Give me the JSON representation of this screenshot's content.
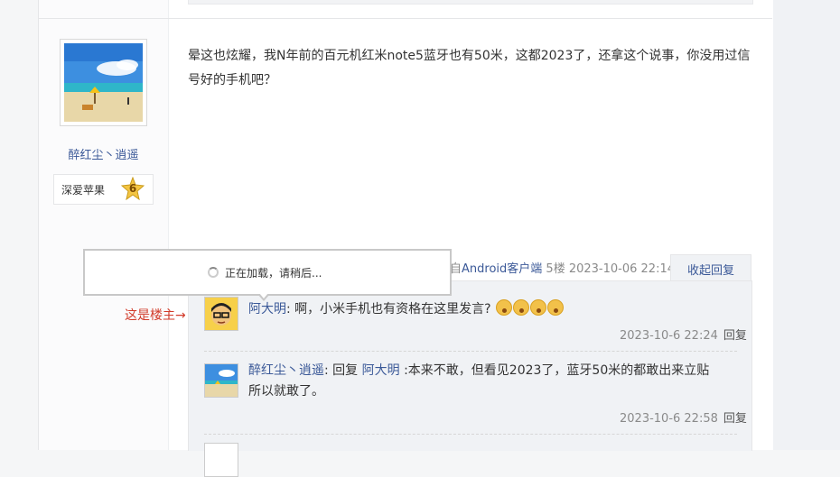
{
  "author": {
    "username": "醉红尘丶逍遥",
    "level_title": "深爱苹果",
    "level_num": "6",
    "avatar": "beach-avatar"
  },
  "post": {
    "content": "晕这也炫耀，我N年前的百元机红米note5蓝牙也有50米，这都2023了，还拿这个说事，你没用过信号好的手机吧？",
    "meta_prefix": "自",
    "client": "Android客户端",
    "floor": "5楼",
    "time": "2023-10-06 22:14",
    "collapse_label": "收起回复"
  },
  "loading": {
    "text": "正在加载，请稍后..."
  },
  "annotation": {
    "op_note": "这是楼主→"
  },
  "replies": [
    {
      "name": "阿大明",
      "colon": ":",
      "text": " 啊，小米手机也有资格在这里发言?",
      "emoji_count": 4,
      "time": "2023-10-6 22:24",
      "reply_label": "回复"
    },
    {
      "name": "醉红尘丶逍遥",
      "colon": ":",
      "reply_word": " 回复 ",
      "target": "阿大明",
      "text_line1": " :本来不敢，但看见2023了，蓝牙50米的都敢出来立贴",
      "text_line2": "所以就敢了。",
      "time": "2023-10-6 22:58",
      "reply_label": "回复"
    }
  ],
  "colors": {
    "link": "#3b5998",
    "annotation": "#d23b2a",
    "muted": "#8a8a8a"
  }
}
